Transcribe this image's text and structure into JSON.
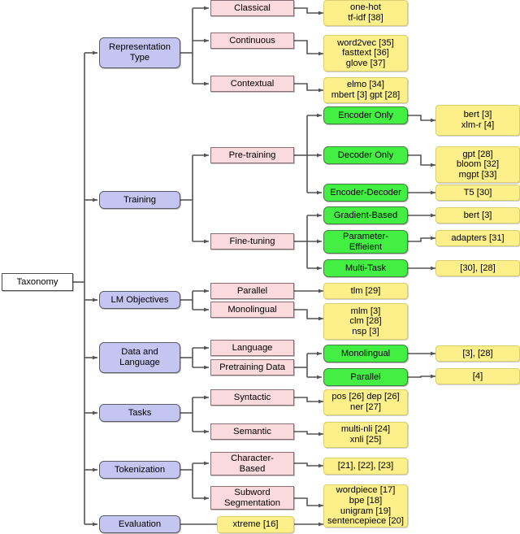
{
  "diagram": {
    "title": "Taxonomy",
    "colors": {
      "root_fill": "#ffffff",
      "level1_fill": "#c5c5f2",
      "level2_fill": "#fadadd",
      "level3_fill": "#44ef44",
      "leaf_fill": "#fdf08a",
      "edge": "#555555"
    }
  },
  "nodes": {
    "root": {
      "label": "Taxonomy"
    },
    "l1": [
      {
        "label": "Representation\nType"
      },
      {
        "label": "Training"
      },
      {
        "label": "LM Objectives"
      },
      {
        "label": "Data and\nLanguage"
      },
      {
        "label": "Tasks"
      },
      {
        "label": "Tokenization"
      },
      {
        "label": "Evaluation"
      }
    ],
    "l2": [
      {
        "label": "Classical"
      },
      {
        "label": "Continuous"
      },
      {
        "label": "Contextual"
      },
      {
        "label": "Pre-training"
      },
      {
        "label": "Fine-tuning"
      },
      {
        "label": "Parallel"
      },
      {
        "label": "Monolingual"
      },
      {
        "label": "Language"
      },
      {
        "label": "Pretraining Data"
      },
      {
        "label": "Syntactic"
      },
      {
        "label": "Semantic"
      },
      {
        "label": "Character-\nBased"
      },
      {
        "label": "Subword\nSegmentation"
      }
    ],
    "l3green": [
      {
        "label": "Encoder Only"
      },
      {
        "label": "Decoder Only"
      },
      {
        "label": "Encoder-Decoder"
      },
      {
        "label": "Gradient-Based"
      },
      {
        "label": "Parameter-\nEffieient"
      },
      {
        "label": "Multi-Task"
      },
      {
        "label": "Monolingual"
      },
      {
        "label": "Parallel"
      }
    ],
    "leaves_col3": [
      {
        "label": "one-hot\ntf-idf [38]"
      },
      {
        "label": "word2vec [35]\nfasttext [36]\nglove [37]"
      },
      {
        "label": "elmo [34]\nmbert [3] gpt [28]"
      },
      {
        "label": "tlm [29]"
      },
      {
        "label": "mlm [3]\nclm [28]\nnsp [3]"
      },
      {
        "label": "pos [26] dep [26]\nner [27]"
      },
      {
        "label": "multi-nli [24]\nxnli [25]"
      },
      {
        "label": "[21], [22], [23]"
      },
      {
        "label": "wordpiece [17]\nbpe [18]\nunigram [19]\nsentencepiece [20]"
      },
      {
        "label": "xtreme [16]"
      }
    ],
    "leaves_col4": [
      {
        "label": "bert [3]\nxlm-r [4]"
      },
      {
        "label": "gpt [28]\nbloom [32]\nmgpt [33]"
      },
      {
        "label": "T5 [30]"
      },
      {
        "label": "bert [3]"
      },
      {
        "label": "adapters [31]"
      },
      {
        "label": "[30], [28]"
      },
      {
        "label": "[3], [28]"
      },
      {
        "label": "[4]"
      }
    ]
  }
}
